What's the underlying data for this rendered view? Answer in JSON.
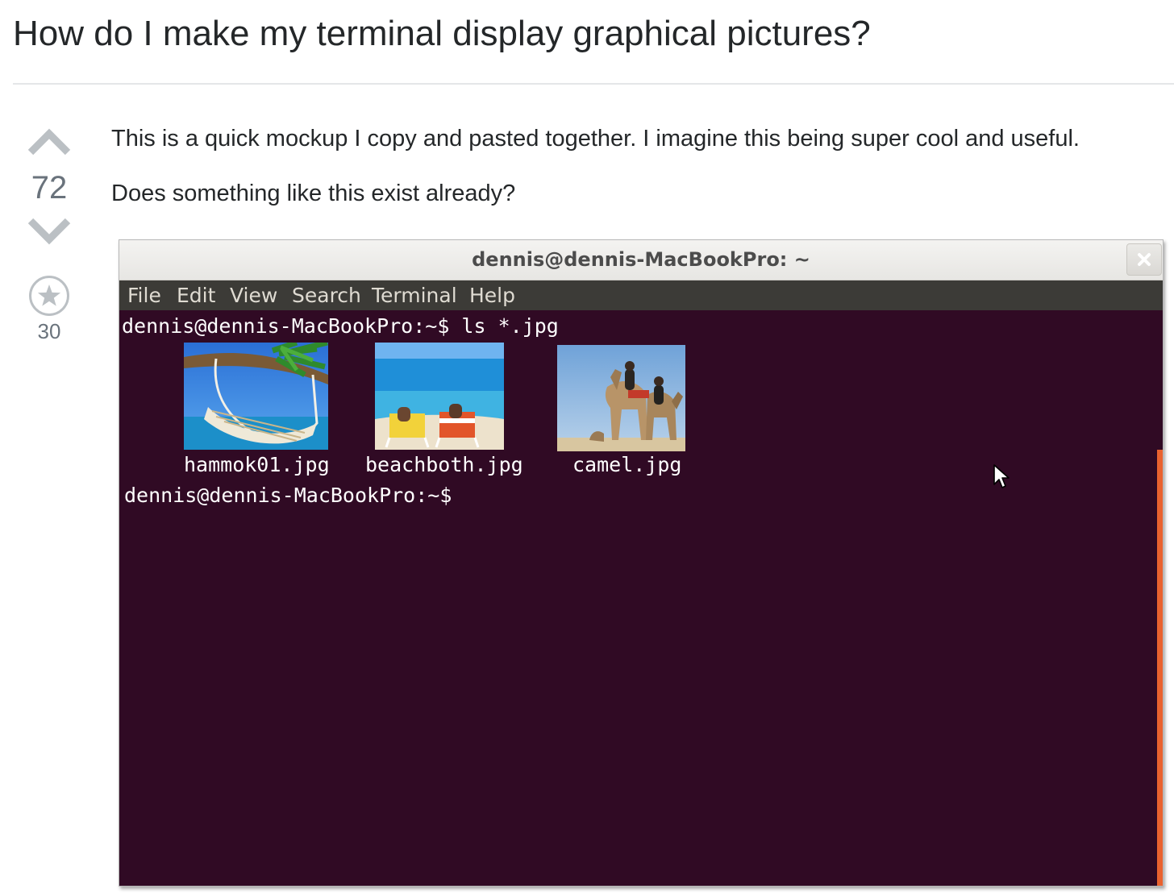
{
  "question": {
    "title": "How do I make my terminal display graphical pictures?",
    "vote_count": "72",
    "favorite_count": "30",
    "body": [
      "This is a quick mockup I copy and pasted together. I imagine this being super cool and useful.",
      "Does something like this exist already?"
    ]
  },
  "icons": {
    "upvote": "upvote-arrow-icon",
    "downvote": "downvote-arrow-icon",
    "favorite": "star-icon",
    "close": "close-icon",
    "cursor": "mouse-pointer-icon"
  },
  "terminal": {
    "window_title": "dennis@dennis-MacBookPro: ~",
    "menu": [
      "File",
      "Edit",
      "View",
      "Search",
      "Terminal",
      "Help"
    ],
    "command_line": "dennis@dennis-MacBookPro:~$ ls *.jpg",
    "files": [
      {
        "name": "hammok01.jpg",
        "image": "hammock-on-beach-photo"
      },
      {
        "name": "beachboth.jpg",
        "image": "two-people-on-beach-chairs-photo"
      },
      {
        "name": "camel.jpg",
        "image": "people-riding-camels-photo"
      }
    ],
    "prompt_line": "dennis@dennis-MacBookPro:~$",
    "colors": {
      "background": "#300a24",
      "menubar": "#3c3b37",
      "scrollbar": "#e9622f",
      "text": "#ffffff"
    }
  },
  "colors": {
    "title_text": "#242729",
    "muted_text": "#6a737c",
    "vote_arrow": "#bbc0c4",
    "divider": "#e4e6e8"
  }
}
